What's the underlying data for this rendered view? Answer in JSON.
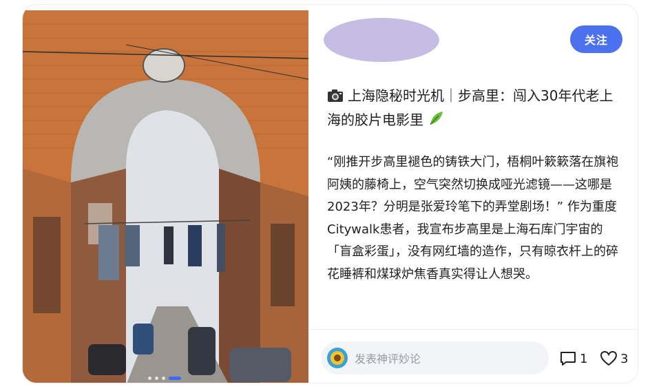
{
  "post": {
    "title": "上海隐秘时光机｜步高里：闯入30年代老上海的胶片电影里",
    "body": "“刚推开步高里褪色的铸铁大门，梧桐叶簌簌落在旗袍阿姨的藤椅上，空气突然切换成哑光滤镜——这哪是2023年？分明是张爱玲笔下的弄堂剧场！” 作为重度Citywalk患者，我宣布步高里是上海石库门宇宙的「盲盒彩蛋」，没有网红墙的造作，只有晾衣杆上的碎花睡裤和煤球炉焦香真实得让人想哭。",
    "title_icon_left": "camera-icon",
    "title_icon_right": "leaf-icon"
  },
  "header": {
    "follow_label": "关注"
  },
  "footer": {
    "comment_placeholder": "发表神评妙论",
    "comment_count": "1",
    "like_count": "3"
  },
  "carousel": {
    "count": 4,
    "active_index": 3
  },
  "colors": {
    "accent": "#4b71ee",
    "brick": "#c8743a",
    "avatar_blur": "#c6bde4"
  }
}
